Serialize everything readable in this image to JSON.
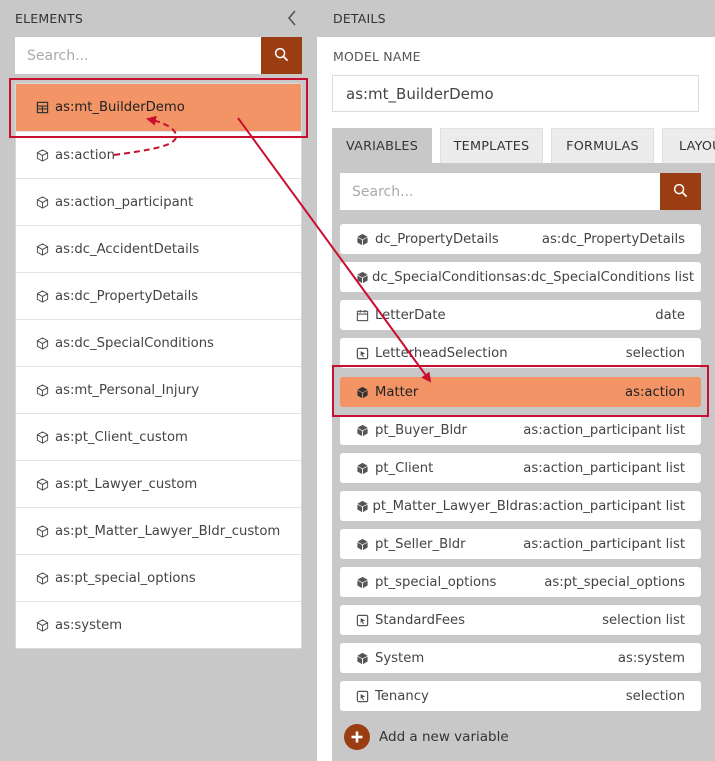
{
  "colors": {
    "accent": "#9b3d12",
    "selected_row": "#f29466",
    "annotation": "#c8102e",
    "panel_bg": "#c8c8c8"
  },
  "elements_panel": {
    "title": "ELEMENTS",
    "search_placeholder": "Search...",
    "items": [
      {
        "label": "as:mt_BuilderDemo",
        "icon": "model-icon",
        "selected": true
      },
      {
        "label": "as:action",
        "icon": "cube-outline-icon"
      },
      {
        "label": "as:action_participant",
        "icon": "cube-outline-icon"
      },
      {
        "label": "as:dc_AccidentDetails",
        "icon": "cube-outline-icon"
      },
      {
        "label": "as:dc_PropertyDetails",
        "icon": "cube-outline-icon"
      },
      {
        "label": "as:dc_SpecialConditions",
        "icon": "cube-outline-icon"
      },
      {
        "label": "as:mt_Personal_Injury",
        "icon": "cube-outline-icon"
      },
      {
        "label": "as:pt_Client_custom",
        "icon": "cube-outline-icon"
      },
      {
        "label": "as:pt_Lawyer_custom",
        "icon": "cube-outline-icon"
      },
      {
        "label": "as:pt_Matter_Lawyer_Bldr_custom",
        "icon": "cube-outline-icon"
      },
      {
        "label": "as:pt_special_options",
        "icon": "cube-outline-icon"
      },
      {
        "label": "as:system",
        "icon": "cube-outline-icon"
      }
    ]
  },
  "details_panel": {
    "title": "DETAILS",
    "model_name_label": "MODEL NAME",
    "model_name_value": "as:mt_BuilderDemo",
    "tabs": [
      {
        "label": "VARIABLES",
        "active": true
      },
      {
        "label": "TEMPLATES"
      },
      {
        "label": "FORMULAS"
      },
      {
        "label": "LAYOUT"
      }
    ],
    "search_placeholder": "Search...",
    "variables": [
      {
        "name": "dc_PropertyDetails",
        "type": "as:dc_PropertyDetails",
        "icon": "cube-solid-icon"
      },
      {
        "name": "dc_SpecialConditions",
        "type": "as:dc_SpecialConditions list",
        "icon": "cube-solid-icon"
      },
      {
        "name": "LetterDate",
        "type": "date",
        "icon": "calendar-icon"
      },
      {
        "name": "LetterheadSelection",
        "type": "selection",
        "icon": "selection-icon"
      },
      {
        "name": "Matter",
        "type": "as:action",
        "icon": "cube-solid-icon",
        "selected": true
      },
      {
        "name": "pt_Buyer_Bldr",
        "type": "as:action_participant list",
        "icon": "cube-solid-icon"
      },
      {
        "name": "pt_Client",
        "type": "as:action_participant list",
        "icon": "cube-solid-icon"
      },
      {
        "name": "pt_Matter_Lawyer_Bldr",
        "type": "as:action_participant list",
        "icon": "cube-solid-icon"
      },
      {
        "name": "pt_Seller_Bldr",
        "type": "as:action_participant list",
        "icon": "cube-solid-icon"
      },
      {
        "name": "pt_special_options",
        "type": "as:pt_special_options",
        "icon": "cube-solid-icon"
      },
      {
        "name": "StandardFees",
        "type": "selection list",
        "icon": "selection-icon"
      },
      {
        "name": "System",
        "type": "as:system",
        "icon": "cube-solid-icon"
      },
      {
        "name": "Tenancy",
        "type": "selection",
        "icon": "selection-icon"
      }
    ],
    "add_variable_label": "Add a new variable"
  }
}
